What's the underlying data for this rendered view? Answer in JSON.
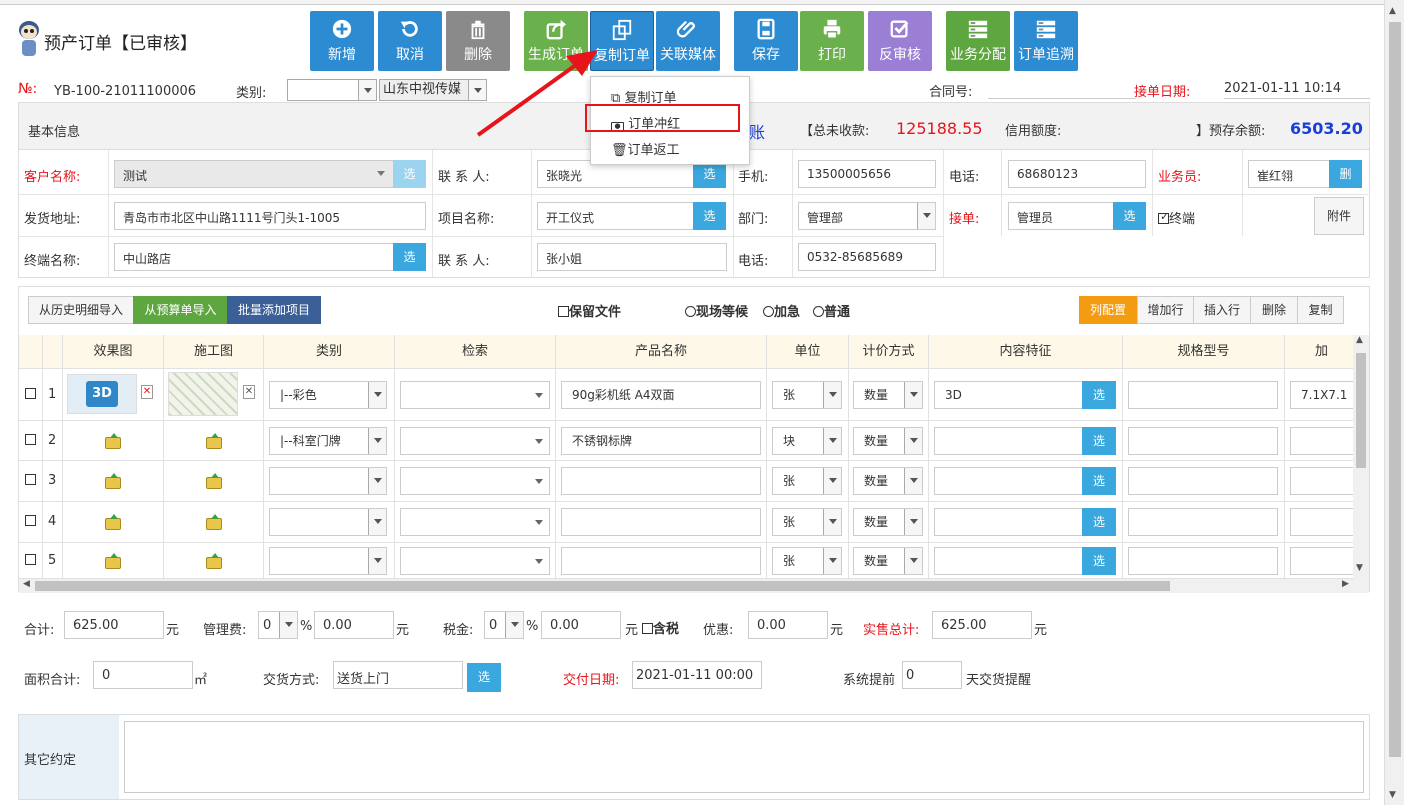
{
  "header": {
    "title": "预产订单【已审核】"
  },
  "toolbar": [
    {
      "label": "新增",
      "icon": "plus-circle-icon",
      "color": "#2d8bd2"
    },
    {
      "label": "取消",
      "icon": "undo-icon",
      "color": "#2d8bd2"
    },
    {
      "label": "删除",
      "icon": "trash-icon",
      "color": "#8a8a8a"
    },
    {
      "label": "生成订单",
      "icon": "export-icon",
      "color": "#6ab04c"
    },
    {
      "label": "复制订单",
      "icon": "copy-icon",
      "color": "#2d8bd2"
    },
    {
      "label": "关联媒体",
      "icon": "paperclip-icon",
      "color": "#2d8bd2"
    },
    {
      "label": "保存",
      "icon": "save-icon",
      "color": "#2d8bd2"
    },
    {
      "label": "打印",
      "icon": "print-icon",
      "color": "#6ab04c"
    },
    {
      "label": "反审核",
      "icon": "check-square-icon",
      "color": "#9b7fd4"
    },
    {
      "label": "业务分配",
      "icon": "server-icon",
      "color": "#5ea640"
    },
    {
      "label": "订单追溯",
      "icon": "server-icon",
      "color": "#2d8bd2"
    }
  ],
  "dropdown_menu": {
    "items": [
      {
        "label": "复制订单",
        "icon": "copy-icon"
      },
      {
        "label": "订单冲红",
        "icon": "money-icon"
      },
      {
        "label": "订单返工",
        "icon": "trash-icon"
      }
    ]
  },
  "order": {
    "no_label": "№:",
    "no_value": "YB-100-21011100006",
    "type_label": "类别:",
    "type_value": "",
    "company_value": "山东中视传媒",
    "contract_label": "合同号:",
    "contract_value": "",
    "date_label": "接单日期:",
    "date_value": "2021-01-11 10:14"
  },
  "basic": {
    "section_title": "基本信息",
    "account_char": "账",
    "total_unpaid_label": "【总未收款:",
    "total_unpaid_value": "125188.55",
    "credit_label": "信用额度:",
    "credit_value": "",
    "prepaid_label": "】预存余额:",
    "prepaid_value": "6503.20",
    "customer_label": "客户名称:",
    "customer_value": "测试",
    "contact_label": "联 系 人:",
    "contact_value": "张晓光",
    "mobile_label": "手机:",
    "mobile_value": "13500005656",
    "phone_label": "电话:",
    "phone_value": "68680123",
    "sales_label": "业务员:",
    "sales_value": "崔红翎",
    "ship_label": "发货地址:",
    "ship_value": "青岛市市北区中山路1111号门头1-1005",
    "project_label": "项目名称:",
    "project_value": "开工仪式",
    "dept_label": "部门:",
    "dept_value": "管理部",
    "receiver_label": "接单:",
    "receiver_value": "管理员",
    "terminal_chk_label": "终端",
    "attach_label": "附件",
    "terminal_label": "终端名称:",
    "terminal_value": "中山路店",
    "contact2_label": "联 系 人:",
    "contact2_value": "张小姐",
    "phone2_label": "电话:",
    "phone2_value": "0532-85685689",
    "pick_label": "选",
    "del_label": "删"
  },
  "grid_toolbar": {
    "import_history": "从历史明细导入",
    "import_budget": "从预算单导入",
    "batch_add": "批量添加项目",
    "keep_file": "保留文件",
    "radio_onsite": "现场等候",
    "radio_urgent": "加急",
    "radio_normal": "普通",
    "col_config": "列配置",
    "add_row": "增加行",
    "insert_row": "插入行",
    "delete": "删除",
    "copy": "复制"
  },
  "grid": {
    "columns": [
      "效果图",
      "施工图",
      "类别",
      "检索",
      "产品名称",
      "单位",
      "计价方式",
      "内容特征",
      "规格型号",
      "加"
    ],
    "rows": [
      {
        "num": "1",
        "category": "|--彩色",
        "product": "90g彩机纸 A4双面",
        "unit": "张",
        "pricing": "数量",
        "content": "3D",
        "spec": "7.1X7.1",
        "thumb_3d": "3D"
      },
      {
        "num": "2",
        "category": "|--科室门牌",
        "product": "不锈钢标牌",
        "unit": "块",
        "pricing": "数量",
        "content": "",
        "spec": ""
      },
      {
        "num": "3",
        "category": "",
        "product": "",
        "unit": "张",
        "pricing": "数量",
        "content": "",
        "spec": ""
      },
      {
        "num": "4",
        "category": "",
        "product": "",
        "unit": "张",
        "pricing": "数量",
        "content": "",
        "spec": ""
      },
      {
        "num": "5",
        "category": "",
        "product": "",
        "unit": "张",
        "pricing": "数量",
        "content": "",
        "spec": ""
      }
    ]
  },
  "totals": {
    "sum_label": "合计:",
    "sum_value": "625.00",
    "yuan": "元",
    "mgmt_label": "管理费:",
    "mgmt_pct": "0",
    "pct": "%",
    "mgmt_value": "0.00",
    "tax_label": "税金:",
    "tax_pct": "0",
    "tax_value": "0.00",
    "tax_incl": "含税",
    "discount_label": "优惠:",
    "discount_value": "0.00",
    "actual_label": "实售总计:",
    "actual_value": "625.00",
    "area_label": "面积合计:",
    "area_value": "0",
    "area_unit": "㎡",
    "delivery_label": "交货方式:",
    "delivery_value": "送货上门",
    "due_label": "交付日期:",
    "due_value": "2021-01-11 00:00",
    "remind_label": "系统提前",
    "remind_value": "0",
    "remind_suffix": "天交货提醒"
  },
  "other": {
    "label": "其它约定",
    "value": ""
  },
  "colors": {
    "accent": "#2d8bd2",
    "red": "#e8141b",
    "orange": "#f39c12",
    "header_bg": "#fdf8e7"
  }
}
